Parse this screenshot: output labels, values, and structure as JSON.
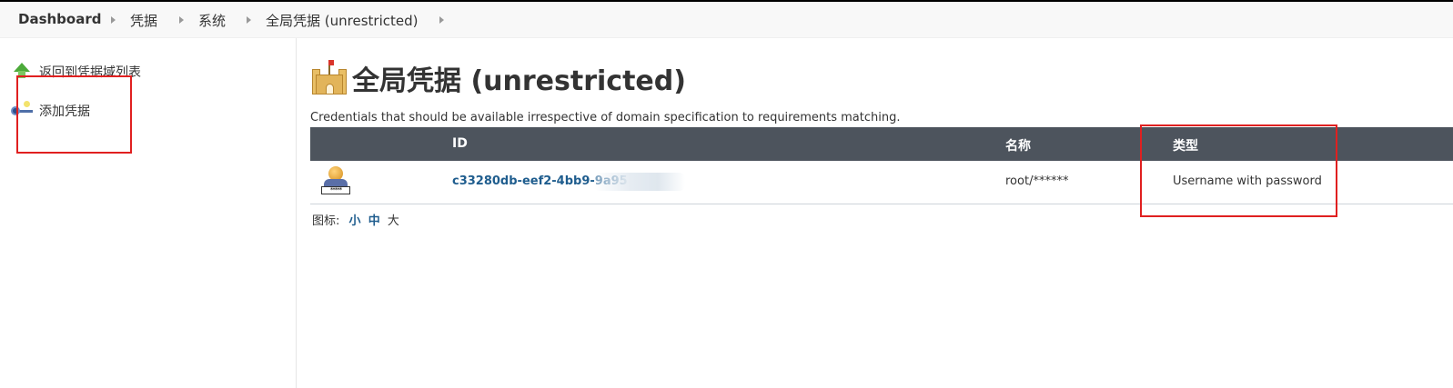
{
  "breadcrumb": {
    "items": [
      "Dashboard",
      "凭据",
      "系统",
      "全局凭据 (unrestricted)"
    ]
  },
  "sidebar": {
    "items": [
      {
        "label": "返回到凭据域列表",
        "icon": "up-arrow-icon"
      },
      {
        "label": "添加凭据",
        "icon": "key-icon"
      }
    ]
  },
  "main": {
    "title": "全局凭据 (unrestricted)",
    "title_icon": "castle-icon",
    "description": "Credentials that should be available irrespective of domain specification to requirements matching.",
    "table": {
      "headers": {
        "icon": "",
        "id": "ID",
        "name": "名称",
        "type": "类型"
      },
      "rows": [
        {
          "icon": "credential-icon",
          "id": "c33280db-eef2-4bb9-9a95",
          "name": "root/******",
          "type": "Username with password"
        }
      ]
    },
    "icon_size": {
      "label": "图标:",
      "small": "小",
      "medium": "中",
      "large": "大"
    }
  },
  "colors": {
    "header_bg": "#4d545d",
    "link": "#1f5d8e",
    "highlight_box": "#e02020"
  }
}
